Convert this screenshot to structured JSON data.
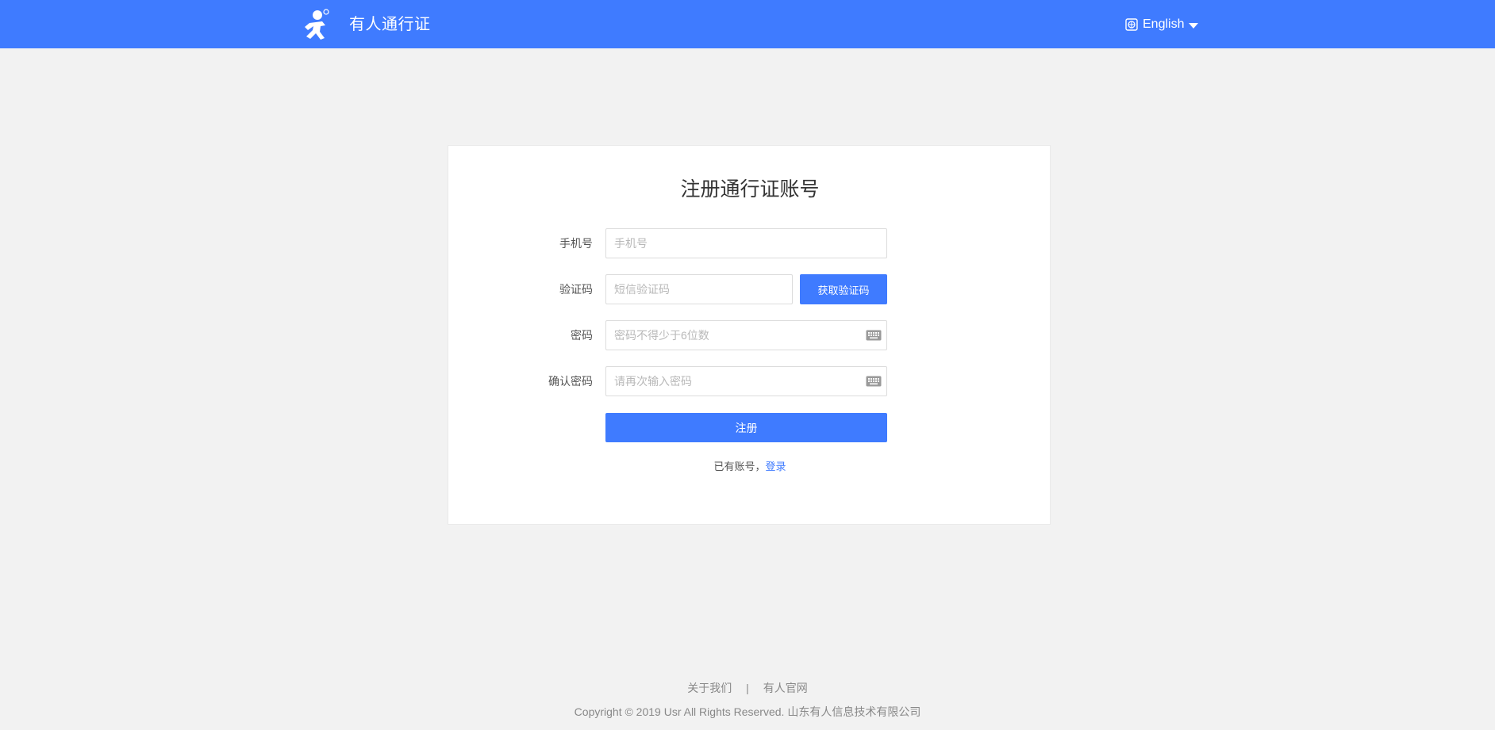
{
  "header": {
    "brand": "有人通行证",
    "language": "English",
    "colors": {
      "primary": "#3f7bff",
      "background": "#f2f2f2"
    }
  },
  "form": {
    "title": "注册通行证账号",
    "phone": {
      "label": "手机号",
      "placeholder": "手机号",
      "value": ""
    },
    "sms_code": {
      "label": "验证码",
      "placeholder": "短信验证码",
      "value": "",
      "button": "获取验证码"
    },
    "password": {
      "label": "密码",
      "placeholder": "密码不得少于6位数",
      "value": "",
      "icon": "keyboard-icon"
    },
    "confirm_password": {
      "label": "确认密码",
      "placeholder": "请再次输入密码",
      "value": "",
      "icon": "keyboard-icon"
    },
    "submit": "注册",
    "have_account_text": "已有账号，",
    "login_link": "登录"
  },
  "footer": {
    "about": "关于我们",
    "separator": "|",
    "official_site": "有人官网",
    "copyright": "Copyright © 2019 Usr All Rights Reserved. 山东有人信息技术有限公司"
  }
}
